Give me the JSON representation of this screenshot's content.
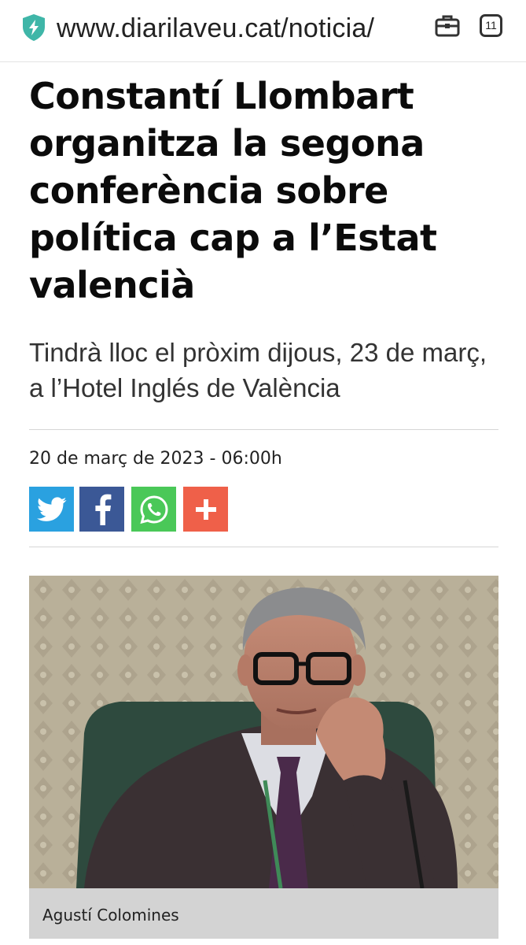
{
  "browser": {
    "url": "www.diarilaveu.cat/noticia/",
    "tab_count": "11",
    "icons": {
      "security": "shield-bolt-icon",
      "action": "briefcase-icon"
    },
    "accent_color": "#3fb6a8"
  },
  "article": {
    "title": "Constantí Llombart organitza la segona conferència sobre política cap a l’Estat valencià",
    "subtitle": "Tindrà lloc el pròxim dijous, 23 de març, a l’Hotel Inglés de València",
    "date": "20 de març de 2023 - 06:00h",
    "share": [
      {
        "name": "twitter",
        "icon": "twitter-bird-icon",
        "color": "#2aa1e0"
      },
      {
        "name": "facebook",
        "icon": "facebook-f-icon",
        "color": "#3b5896"
      },
      {
        "name": "whatsapp",
        "icon": "whatsapp-icon",
        "color": "#4ac858"
      },
      {
        "name": "more",
        "icon": "plus-icon",
        "color": "#ef6049"
      }
    ],
    "photo_caption": "Agustí Colomines"
  }
}
